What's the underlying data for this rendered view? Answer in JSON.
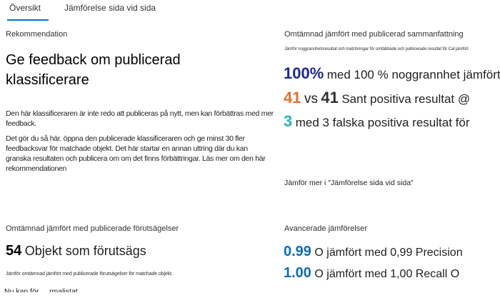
{
  "tabs": [
    {
      "label": "Översikt"
    },
    {
      "label": "Jämförelse sida vid sida"
    }
  ],
  "recommendation": {
    "card_title": "Rekommendation",
    "heading": "Ge feedback om publicerad klassificerare",
    "para1": "Den här klassificeraren är inte redo att publiceras på nytt, men kan förbättras med mer feedback.",
    "para2": "Det gör du så här. öppna den publicerade klassificeraren och ge minst 30 fler feedbacksvar för matchade objekt. Det här startar en annan uttring där du kan granska resultaten och publicera om om det finns förbättringar. Läs mer om den här rekommendationen"
  },
  "summary": {
    "card_title": "Omtämnad jämfört med publicerad sammanfattning",
    "tiny_text": "Jämför noggrannhetsresultat och matchningar för omtäbbade och publicerade resultat för Cal jämfört",
    "stats": [
      {
        "value": "100%",
        "text": "med 100 % noggrannhet jämfört",
        "color": "#1f2a8a"
      },
      {
        "value": "41",
        "vs": "vs",
        "value2": "41",
        "text": "Sant positiva resultat @",
        "color": "#e8712c"
      },
      {
        "value": "3",
        "text": "med 3 falska positiva resultat för",
        "color": "#2bb5b5"
      }
    ],
    "compare_link": "Jämför mer i \"Jämförelse sida vid sida\""
  },
  "predictions": {
    "card_title": "Omtämnad jämfört med publicerade förutsägelser",
    "count": "54",
    "count_text": "Objekt som förutsägs",
    "tiny_text": "Jämför omtämnad jämfört med publicerade förutsägelser för matchade objekt.",
    "cutoff_text": "Nu kan för ... rmalistat"
  },
  "advanced": {
    "card_title": "Avancerade jämförelser",
    "stats": [
      {
        "value": "0.99",
        "text": "O jämfört med 0,99 Precision",
        "color": "#0f6cbd"
      },
      {
        "value": "1.00",
        "text": "O jämfört med 1,00 Recall O",
        "color": "#0f6cbd"
      }
    ]
  }
}
